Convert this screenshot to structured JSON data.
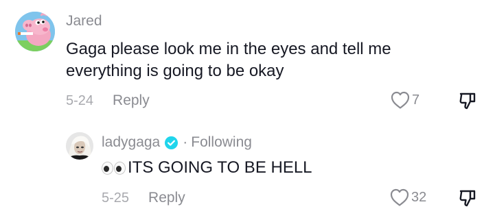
{
  "comments": [
    {
      "username": "Jared",
      "text": "Gaga please look me in the eyes and tell me everything is going to be okay",
      "date": "5-24",
      "reply_label": "Reply",
      "like_count": "7",
      "avatar_icon": "peppa-pig-avatar"
    },
    {
      "username": "ladygaga",
      "verified": true,
      "separator": "·",
      "following_label": "Following",
      "emoji": "eyes-emoji",
      "text": "ITS GOING TO BE HELL",
      "date": "5-25",
      "reply_label": "Reply",
      "like_count": "32",
      "avatar_icon": "ladygaga-avatar"
    }
  ],
  "colors": {
    "text_primary": "#161823",
    "text_secondary": "#8a8b91",
    "verified_blue": "#20d5ec",
    "avatar1_bg": "#7fc4ec",
    "pig_pink": "#f4a7c1"
  }
}
